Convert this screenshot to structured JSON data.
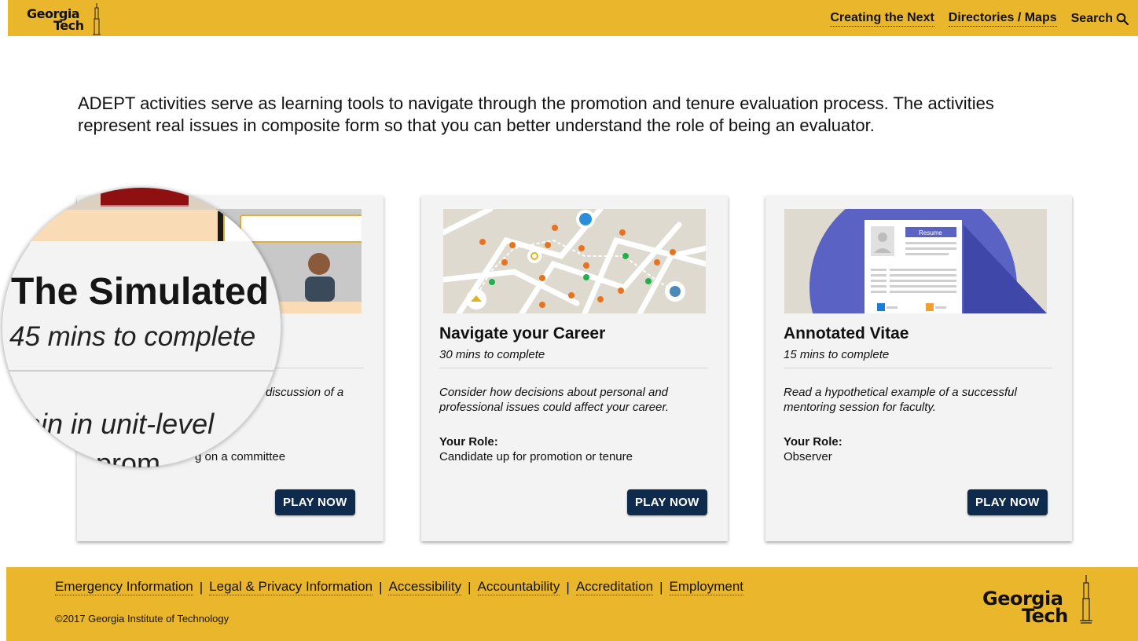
{
  "header": {
    "logo_line1": "Georgia",
    "logo_line2": "Tech",
    "nav": [
      "Creating the Next",
      "Directories / Maps"
    ],
    "search_label": "Search"
  },
  "intro": "ADEPT activities serve as learning tools to navigate through the promotion and tenure evaluation process. The activities represent real issues in composite form so that you can better understand the role of being an evaluator.",
  "cards": [
    {
      "title": "The Simulated",
      "time": "45 mins to complete",
      "desc_visible": "discussion of a",
      "role_value_visible": "g on a committee",
      "button": "PLAY NOW"
    },
    {
      "title": "Navigate your Career",
      "time": "30 mins to complete",
      "desc": "Consider how decisions about personal and professional issues could affect your career.",
      "role_label": "Your Role:",
      "role_value": "Candidate up for promotion or tenure",
      "button": "PLAY NOW"
    },
    {
      "title": "Annotated Vitae",
      "time": "15 mins to complete",
      "desc": "Read a hypothetical example of a successful mentoring session for faculty.",
      "role_label": "Your Role:",
      "role_value": "Observer",
      "button": "PLAY NOW",
      "image_label": "Resume"
    }
  ],
  "magnifier": {
    "title": "The Simulated",
    "time": "45 mins to complete",
    "desc_fragment": "ain in unit-level",
    "role_fragment": "prom"
  },
  "footer": {
    "links": [
      "Emergency Information",
      "Legal & Privacy Information",
      "Accessibility",
      "Accountability",
      "Accreditation",
      "Employment"
    ],
    "separator": "|",
    "copyright": "©2017 Georgia Institute of Technology",
    "logo_line1": "Georgia",
    "logo_line2": "Tech"
  },
  "colors": {
    "gold": "#eab72c",
    "navy": "#0e2a4c",
    "card_bg": "#f3f3f3"
  }
}
